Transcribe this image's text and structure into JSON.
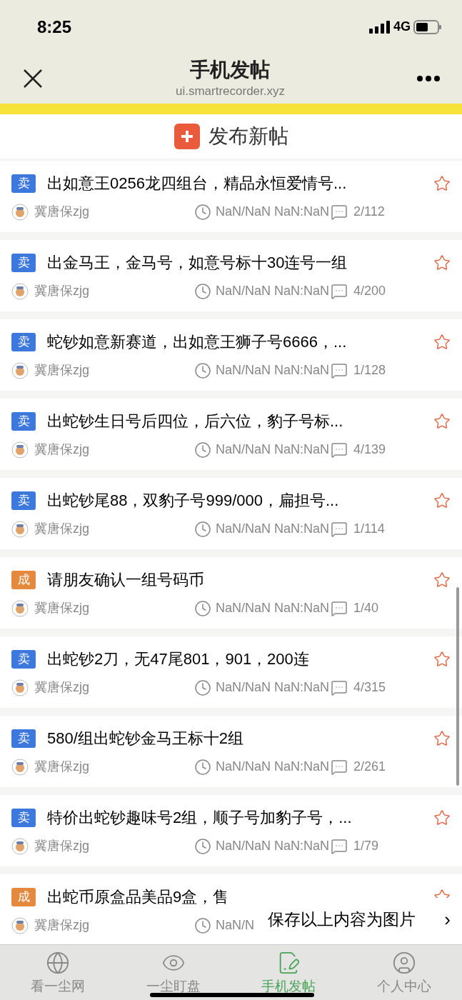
{
  "status_bar": {
    "time": "8:25",
    "network": "4G"
  },
  "header": {
    "title": "手机发帖",
    "url": "ui.smartrecorder.xyz"
  },
  "new_post_button": {
    "label": "发布新帖"
  },
  "posts": [
    {
      "tag": "卖",
      "kind": "sell",
      "title": "出如意王0256龙四组台，精品永恒爱情号...",
      "author": "冀唐保zjg",
      "time": "NaN/NaN NaN:NaN",
      "count": "2/112"
    },
    {
      "tag": "卖",
      "kind": "sell",
      "title": "出金马王，金马号，如意号标十30连号一组",
      "author": "冀唐保zjg",
      "time": "NaN/NaN NaN:NaN",
      "count": "4/200"
    },
    {
      "tag": "卖",
      "kind": "sell",
      "title": "蛇钞如意新赛道，出如意王狮子号6666，...",
      "author": "冀唐保zjg",
      "time": "NaN/NaN NaN:NaN",
      "count": "1/128"
    },
    {
      "tag": "卖",
      "kind": "sell",
      "title": "出蛇钞生日号后四位，后六位，豹子号标...",
      "author": "冀唐保zjg",
      "time": "NaN/NaN NaN:NaN",
      "count": "4/139"
    },
    {
      "tag": "卖",
      "kind": "sell",
      "title": "出蛇钞尾88，双豹子号999/000，扁担号...",
      "author": "冀唐保zjg",
      "time": "NaN/NaN NaN:NaN",
      "count": "1/114"
    },
    {
      "tag": "成",
      "kind": "done",
      "title": "请朋友确认一组号码币",
      "author": "冀唐保zjg",
      "time": "NaN/NaN NaN:NaN",
      "count": "1/40"
    },
    {
      "tag": "卖",
      "kind": "sell",
      "title": "出蛇钞2刀，无47尾801，901，200连",
      "author": "冀唐保zjg",
      "time": "NaN/NaN NaN:NaN",
      "count": "4/315"
    },
    {
      "tag": "卖",
      "kind": "sell",
      "title": "580/组出蛇钞金马王标十2组",
      "author": "冀唐保zjg",
      "time": "NaN/NaN NaN:NaN",
      "count": "2/261"
    },
    {
      "tag": "卖",
      "kind": "sell",
      "title": "特价出蛇钞趣味号2组，顺子号加豹子号，...",
      "author": "冀唐保zjg",
      "time": "NaN/NaN NaN:NaN",
      "count": "1/79"
    },
    {
      "tag": "成",
      "kind": "done",
      "title": "出蛇币原盒品美品9盒，售",
      "author": "冀唐保zjg",
      "time": "NaN/N"
    }
  ],
  "save_popup": {
    "label": "保存以上内容为图片",
    "arrow": "›"
  },
  "tabs": [
    {
      "label": "看一尘网",
      "kind": "globe",
      "selected": false
    },
    {
      "label": "一尘盯盘",
      "kind": "eye",
      "selected": false
    },
    {
      "label": "手机发帖",
      "kind": "edit",
      "selected": true
    },
    {
      "label": "个人中心",
      "kind": "user",
      "selected": false
    }
  ]
}
